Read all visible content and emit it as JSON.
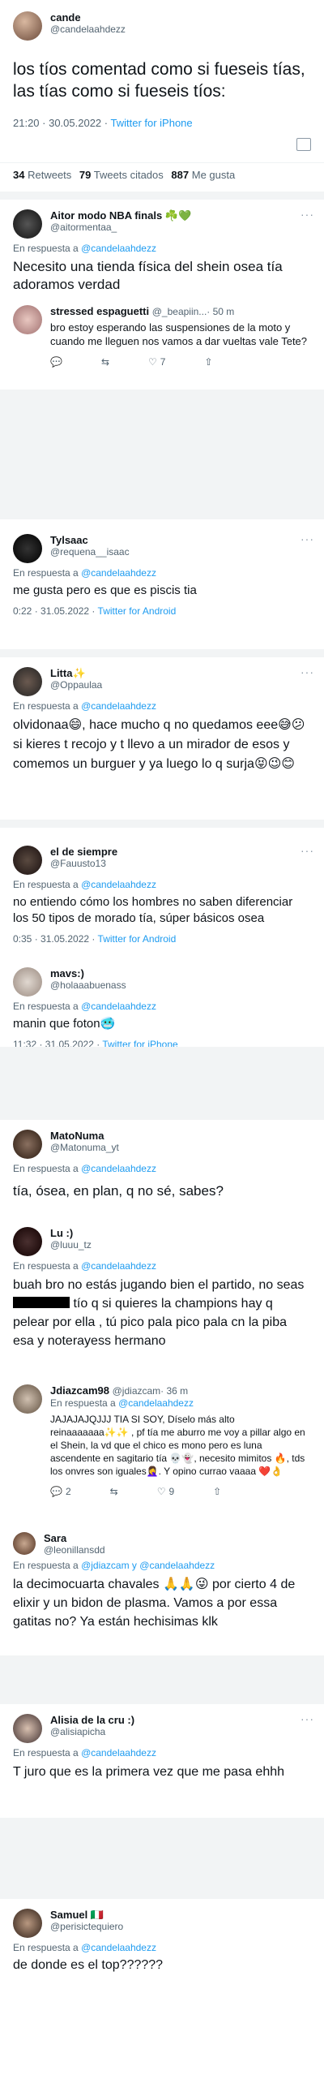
{
  "main": {
    "name": "cande",
    "handle": "@candelaahdezz",
    "text": "los tíos comentad como si fueseis tías, las tías como si fueseis tíos:",
    "time": "21:20 · 30.05.2022 ·",
    "via": "Twitter for iPhone",
    "stats": {
      "retweets_num": "34",
      "retweets_label": "Retweets",
      "quotes_num": "79",
      "quotes_label": "Tweets citados",
      "likes_num": "887",
      "likes_label": "Me gusta"
    }
  },
  "replying_label": "En respuesta a",
  "replies": [
    {
      "name": "Aitor modo NBA finals",
      "emoji": "☘️💚",
      "handle": "@aitormentaa_",
      "to": "@candelaahdezz",
      "text": "Necesito una tienda física del shein osea tía adoramos verdad"
    },
    {
      "name": "stressed espaguetti",
      "handle": "@_beapiin...",
      "time": "· 50 m",
      "text": "bro estoy esperando las suspensiones de la moto y cuando me lleguen nos vamos a dar vueltas vale Tete?",
      "likes": "7"
    },
    {
      "name": "Tylsaac",
      "handle": "@requena__isaac",
      "to": "@candelaahdezz",
      "text": "me gusta pero es que es piscis tia",
      "time": "0:22 · 31.05.2022 ·",
      "via": "Twitter for Android"
    },
    {
      "name": "Litta",
      "emoji": "✨",
      "handle": "@Oppaulaa",
      "to": "@candelaahdezz",
      "text": "olvidonaa😄, hace mucho q no quedamos eee😅😕 si kieres t recojo y t llevo a un mirador de esos y comemos un burguer y ya luego lo q surja😝😉😊"
    },
    {
      "name": "el de siempre",
      "handle": "@Fauusto13",
      "to": "@candelaahdezz",
      "text": "no entiendo cómo los hombres no saben diferenciar los 50 tipos de morado tía, súper básicos osea",
      "time": "0:35 · 31.05.2022 ·",
      "via": "Twitter for Android"
    },
    {
      "name": "mavs:)",
      "handle": "@holaaabuenass",
      "to": "@candelaahdezz",
      "text": "manin que foton🥶",
      "time": "11:32 · 31.05.2022 ·",
      "via": "Twitter for iPhone"
    },
    {
      "name": "MatoNuma",
      "handle": "@Matonuma_yt",
      "to": "@candelaahdezz",
      "text": "tía, ósea, en plan, q no sé, sabes?"
    },
    {
      "name": "Lu :)",
      "handle": "@luuu_tz",
      "to": "@candelaahdezz",
      "text_a": "buah bro no estás jugando bien el partido, no seas",
      "text_b": "tío q si quieres la champions hay q pelear por ella , tú pico pala pico pala cn la piba esa y noterayess hermano"
    },
    {
      "name": "Jdiazcam98",
      "handle": "@jdiazcam",
      "time": "· 36 m",
      "to": "@candelaahdezz",
      "text": "JAJAJAJQJJJ TIA SI SOY, Díselo más alto reinaaaaaaa✨✨ , pf tía me aburro me voy a pillar algo en el Shein, la vd que el chico es mono pero es luna ascendente en sagitario tía 💀👻, necesito mimitos 🔥, tds los onvres son iguales🤦‍♀️. Y opino currao vaaaa ❤️👌",
      "replies": "2",
      "likes": "9"
    },
    {
      "name": "Sara",
      "handle": "@leonillansdd",
      "to": "@jdiazcam y @candelaahdezz",
      "text": "la decimocuarta chavales 🙏🙏😜 por cierto 4 de elixir y un bidon de plasma. Vamos a por essa gatitas no? Ya están hechisimas klk"
    },
    {
      "name": "Alisia de la cru :)",
      "handle": "@alisiapicha",
      "to": "@candelaahdezz",
      "text": "T juro que es la primera vez que me pasa ehhh"
    },
    {
      "name": "Samuel",
      "emoji": "🇮🇹",
      "handle": "@perisictequiero",
      "to": "@candelaahdezz",
      "text": "de donde es el top??????"
    }
  ],
  "icons": {
    "more": "more-dots-icon",
    "reply": "reply-icon",
    "retweet": "retweet-icon",
    "like": "heart-icon",
    "share": "share-icon"
  },
  "colors": {
    "link": "#1d9bf0",
    "muted": "#536471",
    "separator": "#f2f4f5"
  }
}
